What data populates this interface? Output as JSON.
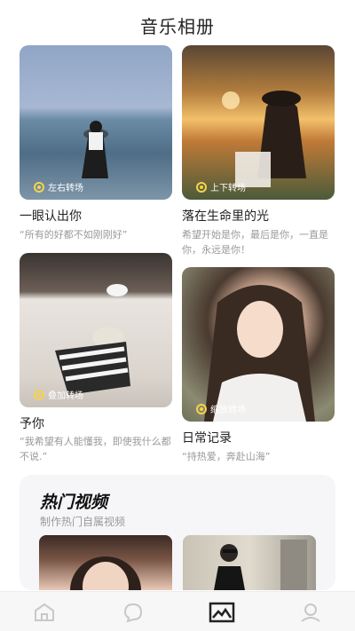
{
  "header": {
    "title": "音乐相册"
  },
  "cards": [
    {
      "badge": "左右转场",
      "title": "一眼认出你",
      "desc": "“所有的好都不如刚刚好”"
    },
    {
      "badge": "上下转场",
      "title": "落在生命里的光",
      "desc": "希望开始是你，最后是你，一直是你，永远是你！"
    },
    {
      "badge": "叠加转场",
      "title": "予你",
      "desc": "“我希望有人能懂我，即使我什么都不说.”"
    },
    {
      "badge": "缩放转场",
      "title": "日常记录",
      "desc": "“持热爱，奔赴山海”"
    }
  ],
  "promo": {
    "title": "热门视频",
    "subtitle": "制作热门自属视频"
  },
  "nav": {
    "items": [
      {
        "icon": "home-icon"
      },
      {
        "icon": "bubble-icon"
      },
      {
        "icon": "image-icon",
        "active": true
      },
      {
        "icon": "profile-icon"
      }
    ]
  },
  "colors": {
    "badge_accent": "#f5d34a",
    "nav_active": "#222222",
    "nav_inactive": "#c8c8c8"
  }
}
